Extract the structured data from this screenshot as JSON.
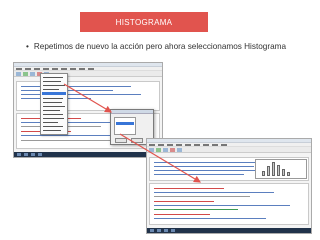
{
  "slide": {
    "title": "HISTOGRAMA",
    "bullet_symbol": "•",
    "bullet_text": "Repetimos de nuevo la acción pero ahora seleccionamos Histograma"
  },
  "colors": {
    "title_bg": "#e1544e",
    "arrow": "#e1544e",
    "selection": "#3875d7"
  }
}
